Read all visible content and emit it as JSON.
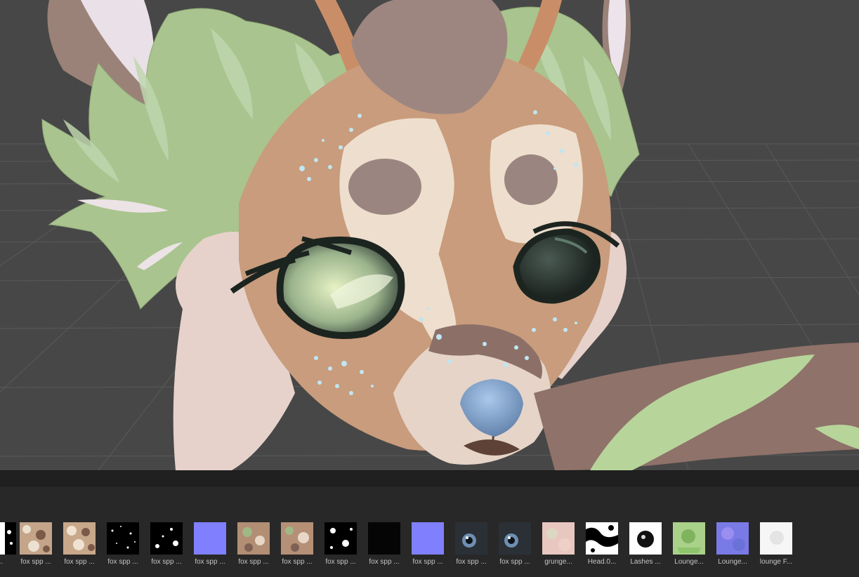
{
  "app": {
    "accent_background": "#474747",
    "panel_background": "#282828"
  },
  "scene_view": {
    "subject": "3d-avatar-head"
  },
  "project_assets": {
    "items": [
      {
        "label": "...",
        "icon": "texture-bw-mask-icon"
      },
      {
        "label": "fox spp ...",
        "icon": "texture-fur-albedo-icon"
      },
      {
        "label": "fox spp ...",
        "icon": "texture-fur-albedo-icon"
      },
      {
        "label": "fox spp ...",
        "icon": "texture-speckle-mask-icon"
      },
      {
        "label": "fox spp ...",
        "icon": "texture-speckle-mask-icon"
      },
      {
        "label": "fox spp ...",
        "icon": "texture-flat-normal-icon"
      },
      {
        "label": "fox spp ...",
        "icon": "texture-fur-albedo-icon"
      },
      {
        "label": "fox spp ...",
        "icon": "texture-fur-albedo-icon"
      },
      {
        "label": "fox spp ...",
        "icon": "texture-speckle-mask-icon"
      },
      {
        "label": "fox spp ...",
        "icon": "texture-black-icon"
      },
      {
        "label": "fox spp ...",
        "icon": "texture-flat-normal-icon"
      },
      {
        "label": "fox spp ...",
        "icon": "texture-eye-icon"
      },
      {
        "label": "fox spp ...",
        "icon": "texture-eye-icon"
      },
      {
        "label": "grunge...",
        "icon": "texture-grunge-icon"
      },
      {
        "label": "Head.0...",
        "icon": "texture-bw-mask-icon"
      },
      {
        "label": "Lashes ...",
        "icon": "texture-lashes-icon"
      },
      {
        "label": "Lounge...",
        "icon": "texture-lounge-albedo-icon"
      },
      {
        "label": "Lounge...",
        "icon": "texture-lounge-normal-icon"
      },
      {
        "label": "lounge F...",
        "icon": "texture-white-icon"
      }
    ]
  }
}
